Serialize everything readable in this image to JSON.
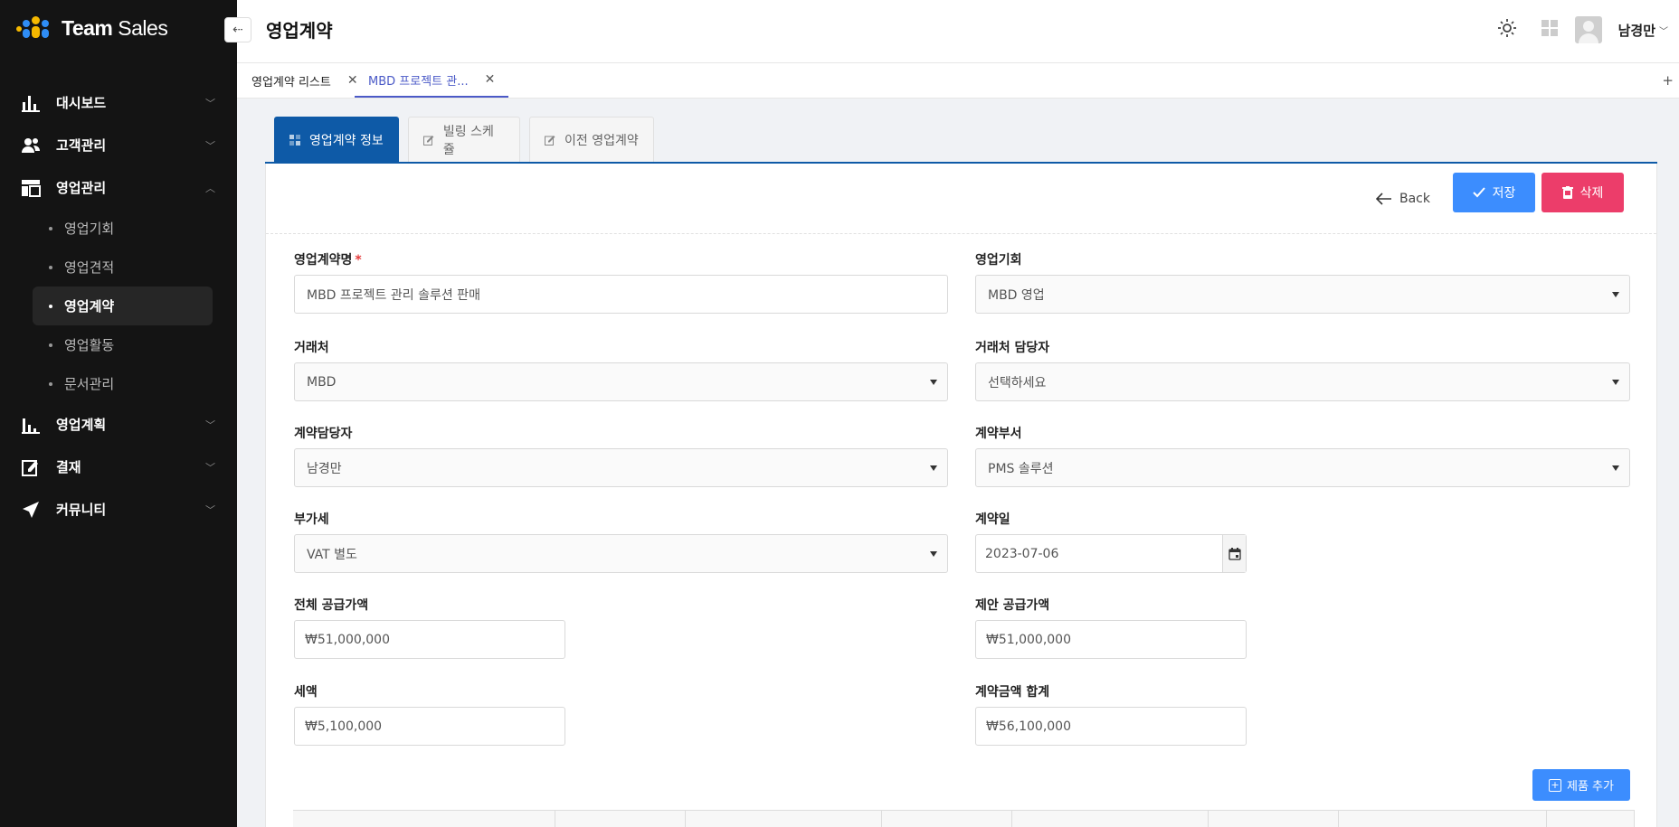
{
  "app": {
    "logo_team": "Team",
    "logo_sales": " Sales"
  },
  "sidebar": {
    "items": [
      {
        "label": "대시보드",
        "icon": "bar-chart-icon"
      },
      {
        "label": "고객관리",
        "icon": "users-icon"
      },
      {
        "label": "영업관리",
        "icon": "layout-icon",
        "expanded": true,
        "children": [
          "영업기회",
          "영업견적",
          "영업계약",
          "영업활동",
          "문서관리"
        ],
        "active_child": "영업계약"
      },
      {
        "label": "영업계획",
        "icon": "chart-plan-icon"
      },
      {
        "label": "결재",
        "icon": "edit-check-icon"
      },
      {
        "label": "커뮤니티",
        "icon": "send-icon"
      }
    ]
  },
  "header": {
    "title": "영업계약",
    "user_name": "남경만"
  },
  "doc_tabs": [
    {
      "label": "영업계약 리스트"
    },
    {
      "label": "MBD 프로젝트 관...",
      "active": true
    }
  ],
  "inner_tabs": [
    "영업계약 정보",
    "빌링 스케쥴",
    "이전 영업계약"
  ],
  "actions": {
    "back": "Back",
    "save": "저장",
    "delete": "삭제",
    "add_product": "제품 추가"
  },
  "form": {
    "contract_name": {
      "label": "영업계약명",
      "value": "MBD 프로젝트 관리 솔루션 판매"
    },
    "opportunity": {
      "label": "영업기회",
      "value": "MBD 영업"
    },
    "client": {
      "label": "거래처",
      "value": "MBD"
    },
    "client_contact": {
      "label": "거래처 담당자",
      "value": "선택하세요"
    },
    "contract_owner": {
      "label": "계약담당자",
      "value": "남경만"
    },
    "department": {
      "label": "계약부서",
      "value": "PMS 솔루션"
    },
    "vat": {
      "label": "부가세",
      "value": "VAT 별도"
    },
    "contract_date": {
      "label": "계약일",
      "value": "2023-07-06"
    },
    "total_supply": {
      "label": "전체 공급가액",
      "value": "₩51,000,000"
    },
    "proposed_supply": {
      "label": "제안 공급가액",
      "value": "₩51,000,000"
    },
    "tax": {
      "label": "세액",
      "value": "₩5,100,000"
    },
    "contract_total": {
      "label": "계약금액 합계",
      "value": "₩56,100,000"
    }
  },
  "colors": {
    "sidebar": "#141414",
    "primary": "#0e5aa7",
    "save": "#3c8dfe",
    "delete": "#ec3d6a",
    "active_tab": "#4b5ac7"
  }
}
